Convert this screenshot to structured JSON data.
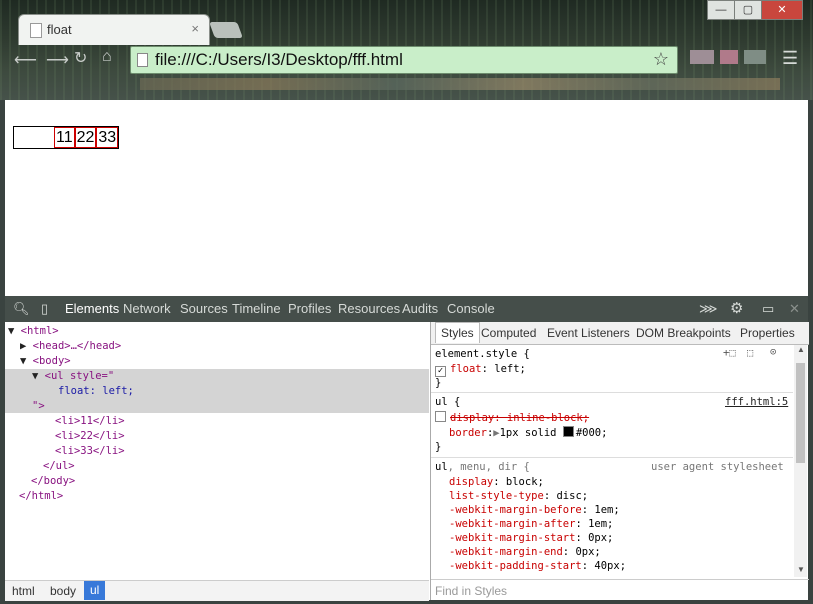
{
  "browser": {
    "tab_title": "float",
    "tab_close": "×",
    "url": "file:///C:/Users/I3/Desktop/fff.html",
    "window_controls": {
      "minimize": "—",
      "maximize": "▢",
      "close": "✕"
    },
    "icons": {
      "back": "back-arrow-icon",
      "forward": "forward-arrow-icon",
      "reload": "reload-icon",
      "home": "home-icon",
      "star": "bookmark-star-icon",
      "menu": "hamburger-menu-icon"
    }
  },
  "page": {
    "list_items": [
      "11",
      "22",
      "33"
    ]
  },
  "devtools": {
    "tabs": [
      "Elements",
      "Network",
      "Sources",
      "Timeline",
      "Profiles",
      "Resources",
      "Audits",
      "Console"
    ],
    "active_tab": "Elements",
    "dom_lines": {
      "html_open": "<html>",
      "head": "<head>…</head>",
      "body_open": "<body>",
      "ul_open": "<ul style=\"",
      "ul_style": "float: left;",
      "ul_close_quote": "\">",
      "li1": "<li>11</li>",
      "li2": "<li>22</li>",
      "li3": "<li>33</li>",
      "ul_close": "</ul>",
      "body_close": "</body>",
      "html_close": "</html>"
    },
    "breadcrumbs": [
      "html",
      "body",
      "ul"
    ],
    "styles_tabs": [
      "Styles",
      "Computed",
      "Event Listeners",
      "DOM Breakpoints",
      "Properties"
    ],
    "styles": {
      "element_style_selector": "element.style {",
      "element_style_prop": "float",
      "element_style_value": " left;",
      "close_brace": "}",
      "rule_ul_selector": "ul {",
      "rule_ul_source": "fff.html:5",
      "rule_ul_prop1": "display: inline-block;",
      "rule_ul_prop2": "border",
      "rule_ul_prop2_value": "1px solid ",
      "rule_ul_prop2_color": "#000;",
      "ua_selector_ul": "ul",
      "ua_selector_rest": ", menu, dir {",
      "ua_source": "user agent stylesheet",
      "ua_props": [
        {
          "name": "display",
          "value": " block;"
        },
        {
          "name": "list-style-type",
          "value": " disc;"
        },
        {
          "name": "-webkit-margin-before",
          "value": " 1em;"
        },
        {
          "name": "-webkit-margin-after",
          "value": " 1em;"
        },
        {
          "name": "-webkit-margin-start",
          "value": " 0px;"
        },
        {
          "name": "-webkit-margin-end",
          "value": " 0px;"
        },
        {
          "name": "-webkit-padding-start",
          "value": " 40px;"
        }
      ]
    },
    "find_placeholder": "Find in Styles"
  }
}
